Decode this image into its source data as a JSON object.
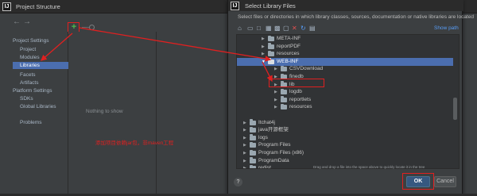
{
  "back_window": {
    "title": "Project Structure",
    "nav_back": "←",
    "nav_forward": "→",
    "toolbar": {
      "add_label": "+",
      "remove_label": "—"
    },
    "sidebar": {
      "project_settings_header": "Project Settings",
      "project_settings_items": [
        "Project",
        "Modules",
        "Libraries",
        "Facets",
        "Artifacts"
      ],
      "platform_settings_header": "Platform Settings",
      "platform_settings_items": [
        "SDKs",
        "Global Libraries"
      ],
      "problems": "Problems",
      "selected_item": "Libraries"
    },
    "panel_empty_text": "Nothing to show",
    "annotation": "添加项目依赖jar包，非maven工程"
  },
  "dialog": {
    "title": "Select Library Files",
    "hint": "Select files or directories in which library classes, sources, documentation or native libraries are located",
    "show_path_label": "Show path",
    "tree_rows": [
      {
        "label": "META-INF",
        "level": 1,
        "expandable": true
      },
      {
        "label": "reportPDF",
        "level": 1,
        "expandable": true
      },
      {
        "label": "resources",
        "level": 1,
        "expandable": true
      },
      {
        "label": "WEB-INF",
        "level": 1,
        "expandable": true,
        "expanded": true,
        "selected": true
      },
      {
        "label": "CSVDownload",
        "level": 2,
        "expandable": true
      },
      {
        "label": "finedb",
        "level": 2,
        "expandable": true
      },
      {
        "label": "lib",
        "level": 2,
        "expandable": true,
        "highlighted": true
      },
      {
        "label": "logdb",
        "level": 2,
        "expandable": true
      },
      {
        "label": "reportlets",
        "level": 2,
        "expandable": true
      },
      {
        "label": "resources",
        "level": 2,
        "expandable": true
      },
      {
        "label": "",
        "level": 1,
        "expandable": false
      },
      {
        "label": "Itchat4j",
        "level": 0,
        "expandable": true
      },
      {
        "label": "java开源框架",
        "level": 0,
        "expandable": true
      },
      {
        "label": "logs",
        "level": 0,
        "expandable": true
      },
      {
        "label": "Program Files",
        "level": 0,
        "expandable": true
      },
      {
        "label": "Program Files (x86)",
        "level": 0,
        "expandable": true
      },
      {
        "label": "ProgramData",
        "level": 0,
        "expandable": true
      },
      {
        "label": "redist",
        "level": 0,
        "expandable": true
      }
    ],
    "drag_hint": "Drag and drop a file into the space above to quickly locate it in the tree",
    "help_label": "?",
    "ok_label": "OK",
    "cancel_label": "Cancel"
  },
  "colors": {
    "selection": "#4b6eaf",
    "annotation_red": "#e02020",
    "add_green": "#4cba4c",
    "link_blue": "#589df6"
  }
}
